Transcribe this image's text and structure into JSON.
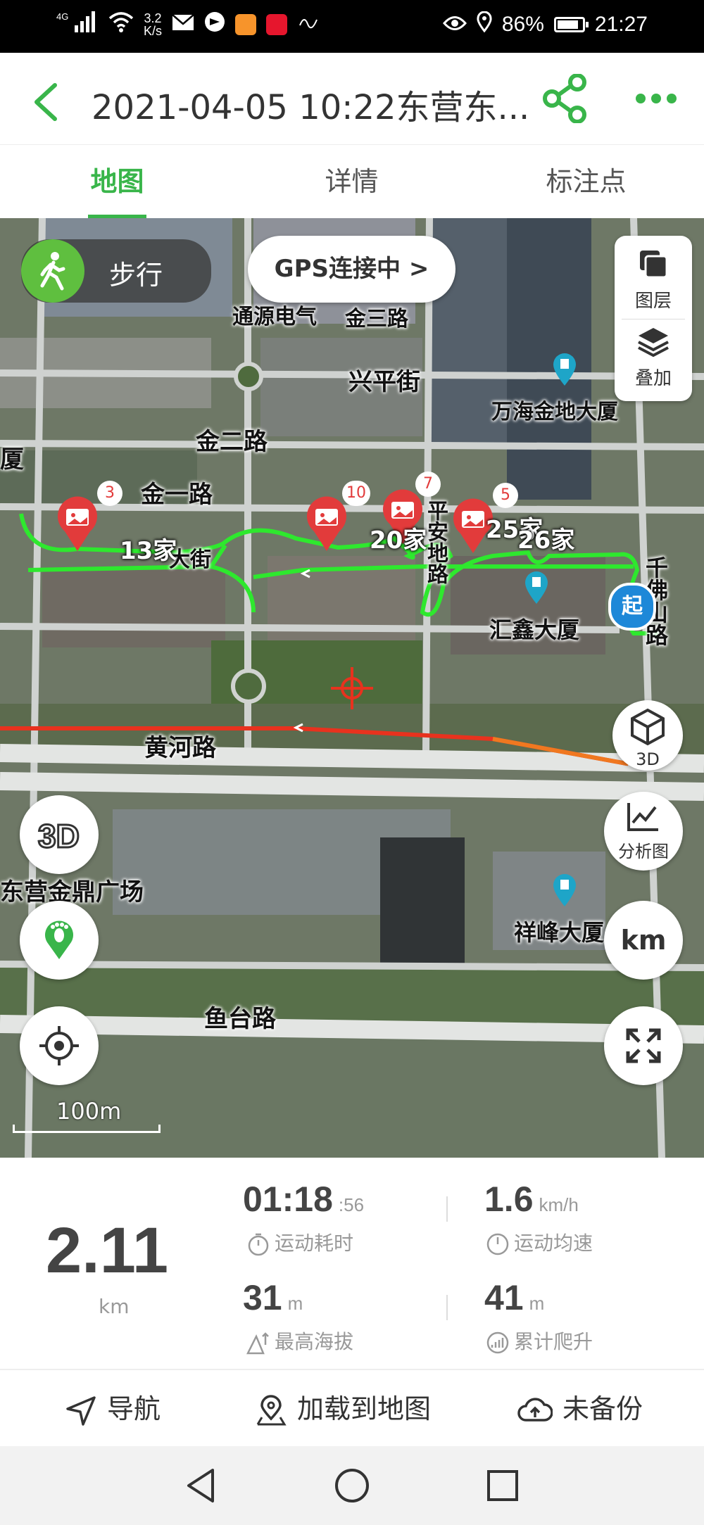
{
  "status_bar": {
    "network": "4G",
    "speed_value": "3.2",
    "speed_unit": "K/s",
    "battery": "86%",
    "battery_level": 0.86,
    "time": "21:27"
  },
  "header": {
    "title": "2021-04-05 10:22东营东...",
    "accent_color": "#39b54a"
  },
  "tabs": [
    {
      "label": "地图",
      "active": true
    },
    {
      "label": "详情",
      "active": false
    },
    {
      "label": "标注点",
      "active": false
    }
  ],
  "map": {
    "mode_label": "步行",
    "gps_status": "GPS连接中 >",
    "layer_label": "图层",
    "overlay_label": "叠加",
    "three_d_label": "3D",
    "analysis_label": "分析图",
    "unit_button": "km",
    "scale_label": "100m",
    "start_marker": "起",
    "route_color": "#2ee82e",
    "alt_route_color": "#e8321e",
    "street_labels": {
      "tongyuan": "通源电气",
      "jinsan": "金三路",
      "xingping": "兴平街",
      "wanhai": "万海金地大厦",
      "jiner": "金二路",
      "jinyi": "金一路",
      "huixin": "汇鑫大厦",
      "huanghe": "黄河路",
      "jinding": "东营金鼎广场",
      "xiangfeng": "祥峰大厦",
      "yutai": "鱼台路",
      "qianfo": "千佛山路",
      "pingan": "平安地路",
      "kaida": "大街",
      "sha": "厦"
    },
    "photo_markers": [
      {
        "count": "3",
        "label": "13家"
      },
      {
        "count": "10",
        "label": ""
      },
      {
        "count": "7",
        "label": "20家"
      },
      {
        "count": "5",
        "label": "25家"
      }
    ],
    "marker_extra_label": "26家"
  },
  "stats": {
    "distance_value": "2.11",
    "distance_unit": "km",
    "duration_main": "01:18",
    "duration_sec": ":56",
    "duration_label": "运动耗时",
    "avg_speed_value": "1.6",
    "avg_speed_unit": "km/h",
    "avg_speed_label": "运动均速",
    "max_alt_value": "31",
    "max_alt_unit": "m",
    "max_alt_label": "最高海拔",
    "climb_value": "41",
    "climb_unit": "m",
    "climb_label": "累计爬升"
  },
  "actions": {
    "navigate": "导航",
    "load_to_map": "加载到地图",
    "backup": "未备份"
  }
}
